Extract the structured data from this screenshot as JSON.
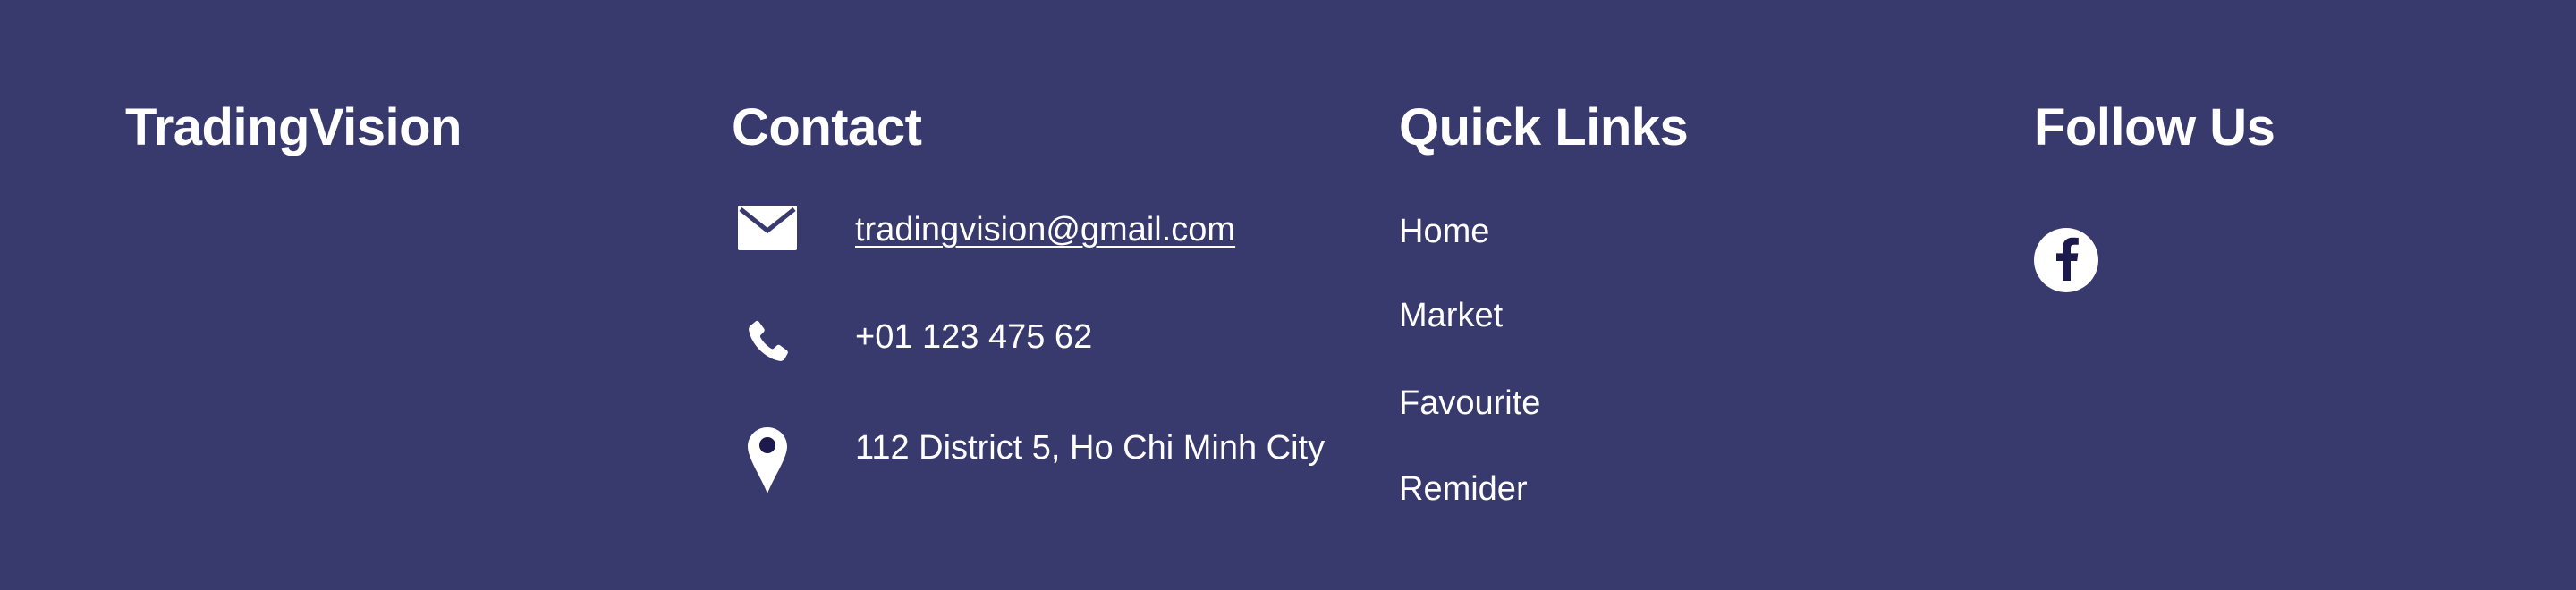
{
  "brand": {
    "name": "TradingVision"
  },
  "contact": {
    "heading": "Contact",
    "email": {
      "icon": "envelope-icon",
      "value": "tradingvision@gmail.com"
    },
    "phone": {
      "icon": "phone-icon",
      "value": "+01 123 475 62"
    },
    "address": {
      "icon": "map-pin-icon",
      "value": "112 District 5, Ho Chi Minh City"
    }
  },
  "quick_links": {
    "heading": "Quick Links",
    "items": [
      {
        "label": "Home"
      },
      {
        "label": "Market"
      },
      {
        "label": "Favourite"
      },
      {
        "label": "Remider"
      }
    ]
  },
  "follow": {
    "heading": "Follow Us",
    "icons": [
      "facebook-icon"
    ]
  },
  "colors": {
    "background": "#383a6d",
    "text": "#ffffff",
    "icon_dark": "#1c1a4c"
  }
}
